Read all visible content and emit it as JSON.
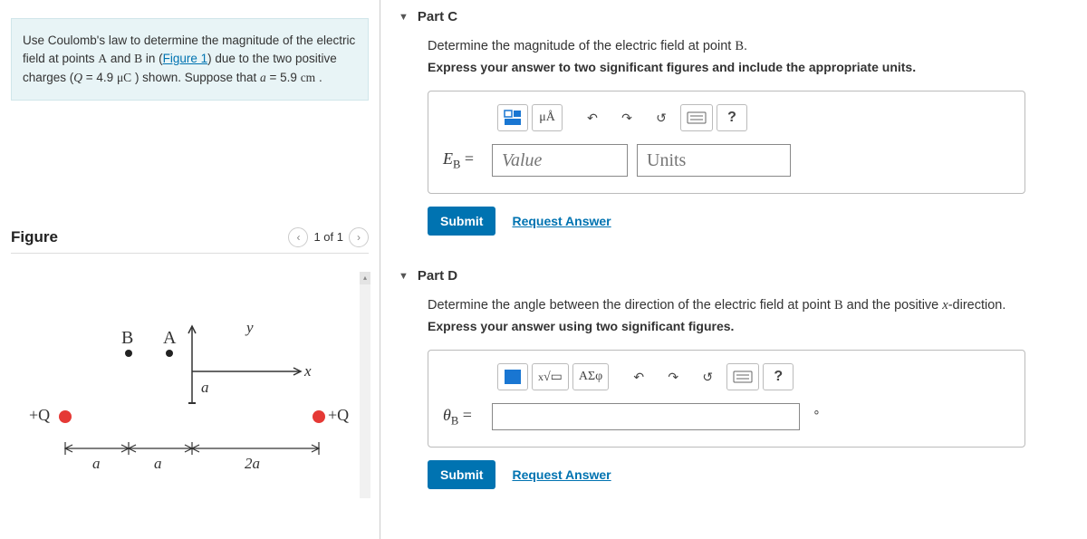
{
  "problem": {
    "text_pre": "Use Coulomb's law to determine the magnitude of the electric field at points ",
    "point_a": "A",
    "text_mid1": " and ",
    "point_b": "B",
    "text_mid2": " in (",
    "figure_link": "Figure 1",
    "text_mid3": ") due to the two positive charges (",
    "q_var": "Q",
    "q_eq": " = 4.9 ",
    "q_unit": "μC",
    "text_mid4": " ) shown. Suppose that ",
    "a_var": "a",
    "a_eq": " = 5.9 ",
    "a_unit": "cm",
    "text_end": " ."
  },
  "figure": {
    "title": "Figure",
    "pager": "1 of 1",
    "labels": {
      "B": "B",
      "A": "A",
      "y": "y",
      "x": "x",
      "a_mid": "a",
      "plusQ_left": "+Q",
      "plusQ_right": "+Q",
      "dim_a1": "a",
      "dim_a2": "a",
      "dim_2a": "2a"
    }
  },
  "part_c": {
    "header": "Part C",
    "prompt_pre": "Determine the magnitude of the electric field at point ",
    "prompt_point": "B",
    "prompt_post": ".",
    "instruction": "Express your answer to two significant figures and include the appropriate units.",
    "eq_label_html": "E",
    "eq_sub": "B",
    "eq_sign": " =",
    "value_ph": "Value",
    "units_ph": "Units",
    "tool_units": "μÅ",
    "submit": "Submit",
    "request": "Request Answer"
  },
  "part_d": {
    "header": "Part D",
    "prompt_pre": "Determine the angle between the direction of the electric field at point ",
    "prompt_point": "B",
    "prompt_post": " and the positive ",
    "prompt_xvar": "x",
    "prompt_end": "-direction.",
    "instruction": "Express your answer using two significant figures.",
    "eq_label": "θ",
    "eq_sub": "B",
    "eq_sign": " =",
    "tool_greek": "ΑΣφ",
    "deg": "∘",
    "submit": "Submit",
    "request": "Request Answer"
  }
}
